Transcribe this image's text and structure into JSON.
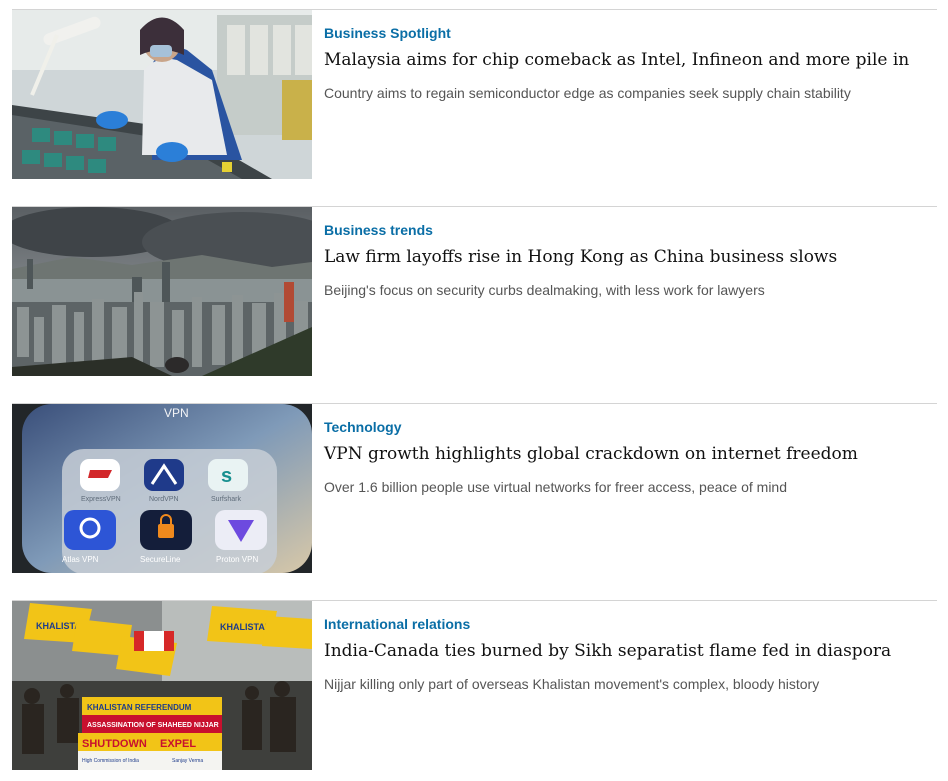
{
  "articles": [
    {
      "kicker": "Business Spotlight",
      "headline": "Malaysia aims for chip comeback as Intel, Infineon and more pile in",
      "summary": "Country aims to regain semiconductor edge as companies seek supply chain stability"
    },
    {
      "kicker": "Business trends",
      "headline": "Law firm layoffs rise in Hong Kong as China business slows",
      "summary": "Beijing's focus on security curbs dealmaking, with less work for lawyers"
    },
    {
      "kicker": "Technology",
      "headline": "VPN growth highlights global crackdown on internet freedom",
      "summary": "Over 1.6 billion people use virtual networks for freer access, peace of mind",
      "image_text": {
        "screen_title": "VPN",
        "apps": [
          "ExpressVPN",
          "NordVPN",
          "Surfshark",
          "Atlas VPN",
          "SecureLine",
          "Proton VPN"
        ]
      }
    },
    {
      "kicker": "International relations",
      "headline": "India-Canada ties burned by Sikh separatist flame fed in diaspora",
      "summary": "Nijjar killing only part of overseas Khalistan movement's complex, bloody history",
      "image_text": {
        "flag_text": "KHALISTAN",
        "banner_top": "KHALISTAN REFERENDUM",
        "banner_mid": "ASSASSINATION OF SHAHEED NIJJAR",
        "sign_left": "SHUTDOWN",
        "sign_right": "EXPEL",
        "caption_left": "High Commission of India",
        "caption_right": "Sanjay Verma"
      }
    }
  ],
  "colors": {
    "kicker": "#0a6ea6",
    "headline": "#111111",
    "summary": "#555555",
    "divider": "#d4d4d4"
  }
}
